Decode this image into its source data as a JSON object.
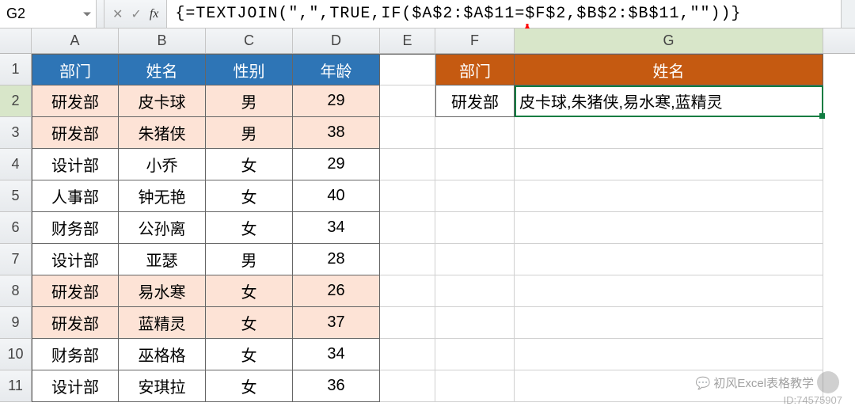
{
  "name_box": "G2",
  "formula": "{=TEXTJOIN(\",\",TRUE,IF($A$2:$A$11=$F$2,$B$2:$B$11,\"\"))}",
  "columns": [
    "A",
    "B",
    "C",
    "D",
    "E",
    "F",
    "G"
  ],
  "col_widths": {
    "A": 110,
    "B": 110,
    "C": 110,
    "D": 110,
    "E": 70,
    "F": 100,
    "G": 390
  },
  "row_numbers": [
    1,
    2,
    3,
    4,
    5,
    6,
    7,
    8,
    9,
    10,
    11
  ],
  "left_table": {
    "headers": {
      "A": "部门",
      "B": "姓名",
      "C": "性别",
      "D": "年龄"
    },
    "rows": [
      {
        "A": "研发部",
        "B": "皮卡球",
        "C": "男",
        "D": "29",
        "peach": true
      },
      {
        "A": "研发部",
        "B": "朱猪侠",
        "C": "男",
        "D": "38",
        "peach": true
      },
      {
        "A": "设计部",
        "B": "小乔",
        "C": "女",
        "D": "29",
        "peach": false
      },
      {
        "A": "人事部",
        "B": "钟无艳",
        "C": "女",
        "D": "40",
        "peach": false
      },
      {
        "A": "财务部",
        "B": "公孙离",
        "C": "女",
        "D": "34",
        "peach": false
      },
      {
        "A": "设计部",
        "B": "亚瑟",
        "C": "男",
        "D": "28",
        "peach": false
      },
      {
        "A": "研发部",
        "B": "易水寒",
        "C": "女",
        "D": "26",
        "peach": true
      },
      {
        "A": "研发部",
        "B": "蓝精灵",
        "C": "女",
        "D": "37",
        "peach": true
      },
      {
        "A": "财务部",
        "B": "巫格格",
        "C": "女",
        "D": "34",
        "peach": false
      },
      {
        "A": "设计部",
        "B": "安琪拉",
        "C": "女",
        "D": "36",
        "peach": false
      }
    ]
  },
  "right_table": {
    "headers": {
      "F": "部门",
      "G": "姓名"
    },
    "row": {
      "F": "研发部",
      "G": "皮卡球,朱猪侠,易水寒,蓝精灵"
    }
  },
  "selected_cell": "G2",
  "watermark": {
    "line1": "初风Excel表格教学",
    "line2": "ID:74575907"
  }
}
